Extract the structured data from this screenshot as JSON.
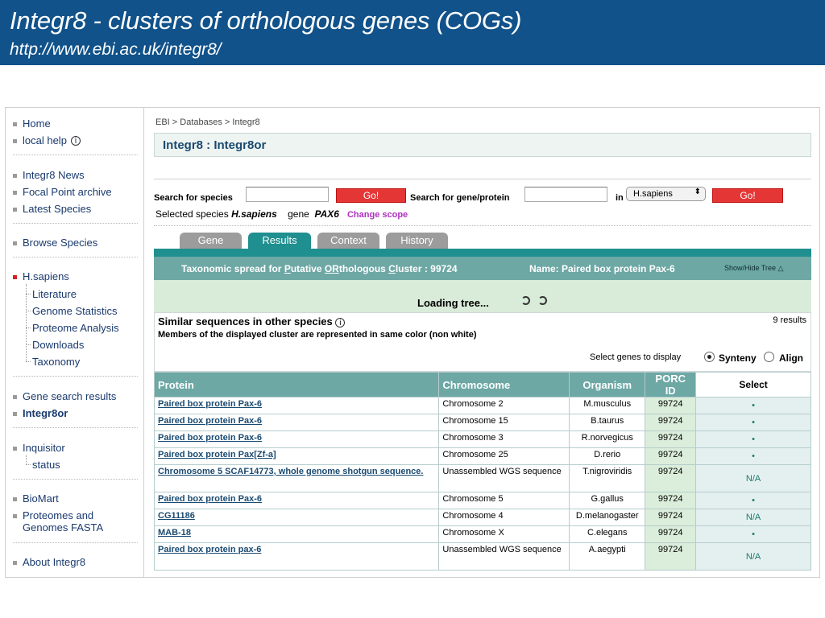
{
  "slide": {
    "title": "Integr8 - clusters of orthologous genes (COGs)",
    "url": "http://www.ebi.ac.uk/integr8/"
  },
  "sidebar": {
    "home": "Home",
    "local_help": "local help",
    "news": "Integr8 News",
    "focal": "Focal Point archive",
    "latest": "Latest Species",
    "browse": "Browse Species",
    "species": "H.sapiens",
    "sub": [
      "Literature",
      "Genome Statistics",
      "Proteome Analysis",
      "Downloads",
      "Taxonomy"
    ],
    "gene_search": "Gene search results",
    "integr8or": "Integr8or",
    "inquisitor": "Inquisitor",
    "status": "status",
    "biomart": "BioMart",
    "proteomes1": "Proteomes and",
    "proteomes2": "Genomes FASTA",
    "about": "About Integr8"
  },
  "breadcrumb": "EBI  >  Databases  >  Integr8",
  "page_title": "Integr8 :  Integr8or",
  "search": {
    "species_label": "Search for species",
    "go": "Go!",
    "gene_label": "Search for gene/protein",
    "in_label": "in",
    "species_select": "H.sapiens"
  },
  "scope": {
    "selected_label": "Selected species",
    "species": "H.sapiens",
    "gene_label": "gene",
    "gene": "PAX6",
    "change": "Change scope"
  },
  "tabs": [
    "Gene",
    "Results",
    "Context",
    "History"
  ],
  "spread": {
    "title_pre": "Taxonomic spread for ",
    "p": "P",
    "utative": "utative ",
    "or": "OR",
    "thologous": "thologous ",
    "c": "C",
    "luster": "luster : 99724",
    "name": "Name: Paired box protein Pax-6",
    "toggle": "Show/Hide Tree"
  },
  "loading": "Loading tree...",
  "similar": {
    "heading": "Similar sequences in other species",
    "sub": "Members of the displayed cluster are represented in same color (non white)",
    "results": "9 results",
    "display": "Select genes to display",
    "synteny": "Synteny",
    "align": "Align"
  },
  "table": {
    "headers": [
      "Protein",
      "Chromosome",
      "Organism",
      "PORC ID",
      "Select"
    ],
    "rows": [
      {
        "protein": "Paired box protein Pax-6",
        "chromosome": "Chromosome 2",
        "organism": "M.musculus",
        "porc": "99724",
        "select": "•"
      },
      {
        "protein": "Paired box protein Pax-6",
        "chromosome": "Chromosome 15",
        "organism": "B.taurus",
        "porc": "99724",
        "select": "•"
      },
      {
        "protein": "Paired box protein Pax-6",
        "chromosome": "Chromosome 3",
        "organism": "R.norvegicus",
        "porc": "99724",
        "select": "•"
      },
      {
        "protein": "Paired box protein Pax[Zf-a]",
        "chromosome": "Chromosome 25",
        "organism": "D.rerio",
        "porc": "99724",
        "select": "•"
      },
      {
        "protein": "Chromosome 5 SCAF14773, whole genome shotgun sequence.",
        "chromosome": "Unassembled WGS sequence",
        "organism": "T.nigroviridis",
        "porc": "99724",
        "select": "N/A"
      },
      {
        "protein": "Paired box protein Pax-6",
        "chromosome": "Chromosome 5",
        "organism": "G.gallus",
        "porc": "99724",
        "select": "•"
      },
      {
        "protein": "CG11186",
        "chromosome": "Chromosome 4",
        "organism": "D.melanogaster",
        "porc": "99724",
        "select": "N/A"
      },
      {
        "protein": "MAB-18",
        "chromosome": "Chromosome X",
        "organism": "C.elegans",
        "porc": "99724",
        "select": "•"
      },
      {
        "protein": "Paired box protein pax-6",
        "chromosome": "Unassembled WGS sequence",
        "organism": "A.aegypti",
        "porc": "99724",
        "select": "N/A"
      }
    ]
  },
  "colors": {
    "banner": "#11528a",
    "teal": "#1f8f8f",
    "go": "#e53636"
  }
}
